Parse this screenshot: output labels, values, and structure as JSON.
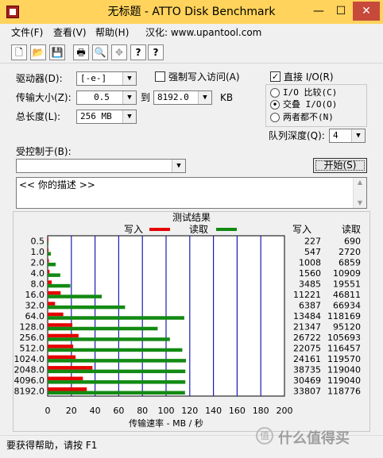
{
  "window": {
    "title": "无标题 - ATTO Disk Benchmark",
    "minimize_glyph": "—",
    "maximize_glyph": "☐",
    "close_glyph": "✕"
  },
  "menu": [
    "文件(F)",
    "查看(V)",
    "帮助(H)",
    "汉化: www.upantool.com"
  ],
  "toolbar": {
    "icons": [
      "new-file-icon",
      "open-folder-icon",
      "save-icon",
      "print-icon",
      "print-preview-icon",
      "move-icon",
      "help-icon",
      "context-help-icon"
    ],
    "glyphs": [
      "🗋",
      "📂",
      "💾",
      "🖶",
      "🔍",
      "✥",
      "?",
      "?"
    ]
  },
  "settings": {
    "drive_label": "驱动器(D):",
    "drive_value": "[-e-]",
    "force_write_label": "强制写入访问(A)",
    "force_write_checked": false,
    "transfer_size_label": "传输大小(Z):",
    "transfer_from": "0.5",
    "to_label": "到",
    "transfer_to": "8192.0",
    "transfer_unit": "KB",
    "total_length_label": "总长度(L):",
    "total_length_value": "256 MB",
    "direct_io_label": "直接 I/O(R)",
    "direct_io_checked": true,
    "io_compare_label": "I/O 比较(C)",
    "overlap_io_label": "交叠 I/O(O)",
    "neither_label": "两者都不(N)",
    "io_mode_selected": "overlap",
    "queue_depth_label": "队列深度(Q):",
    "queue_depth_value": "4",
    "controlled_by_label": "受控制于(B):",
    "controlled_by_value": "",
    "start_button": "开始(S)",
    "description_text": "<<  你的描述  >>"
  },
  "chart_data": {
    "type": "bar",
    "title": "测试结果",
    "legend": [
      {
        "name": "写入",
        "color": "#e60000"
      },
      {
        "name": "读取",
        "color": "#138a13"
      }
    ],
    "categories": [
      "0.5",
      "1.0",
      "2.0",
      "4.0",
      "8.0",
      "16.0",
      "32.0",
      "64.0",
      "128.0",
      "256.0",
      "512.0",
      "1024.0",
      "2048.0",
      "4096.0",
      "8192.0"
    ],
    "series": [
      {
        "name": "写入",
        "values": [
          227,
          547,
          1008,
          1560,
          3485,
          11221,
          6387,
          13484,
          21347,
          26722,
          22075,
          24161,
          38735,
          30469,
          33807
        ]
      },
      {
        "name": "读取",
        "values": [
          690,
          2720,
          6859,
          10909,
          19551,
          46811,
          66934,
          118169,
          95120,
          105693,
          116457,
          119570,
          119040,
          119040,
          118776
        ]
      }
    ],
    "write_col_header": "写入",
    "read_col_header": "读取",
    "xlabel": "传输速率 - MB / 秒",
    "xlim": [
      0,
      200
    ],
    "xticks": [
      "0",
      "20",
      "40",
      "60",
      "80",
      "100",
      "120",
      "140",
      "160",
      "180",
      "200"
    ],
    "grid": true,
    "grid_color": "#1a1ab4"
  },
  "status": {
    "text": "要获得帮助，请按 F1"
  },
  "watermark": {
    "icon_glyph": "值",
    "text": "什么值得买"
  }
}
